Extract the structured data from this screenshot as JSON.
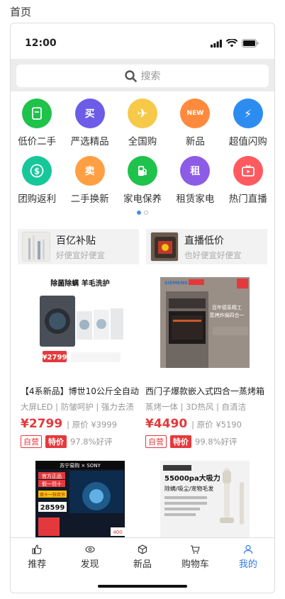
{
  "page_label": "首页",
  "status": {
    "time": "12:00"
  },
  "search": {
    "placeholder": "搜索"
  },
  "categories": [
    {
      "label": "低价二手",
      "color": "#1fc24b",
      "icon": "tablet-icon",
      "glyph": ""
    },
    {
      "label": "严选精品",
      "color": "#6c5ce7",
      "icon": "buy-icon",
      "glyph": "买"
    },
    {
      "label": "全国购",
      "color": "#f7c948",
      "icon": "plane-icon",
      "glyph": "✈"
    },
    {
      "label": "新品",
      "color": "#ff8a3d",
      "icon": "new-icon",
      "glyph": "NEW"
    },
    {
      "label": "超值闪购",
      "color": "#2d8cf0",
      "icon": "bolt-icon",
      "glyph": "⚡"
    },
    {
      "label": "团购返利",
      "color": "#16c79a",
      "icon": "dollar-icon",
      "glyph": "$"
    },
    {
      "label": "二手换新",
      "color": "#ff9f43",
      "icon": "sell-icon",
      "glyph": "卖"
    },
    {
      "label": "家电保养",
      "color": "#1fc24b",
      "icon": "fuel-icon",
      "glyph": "⛽"
    },
    {
      "label": "租赁家电",
      "color": "#8c5ce7",
      "icon": "rent-icon",
      "glyph": "租"
    },
    {
      "label": "热门直播",
      "color": "#ff5a5f",
      "icon": "tv-icon",
      "glyph": "▶"
    }
  ],
  "promos": [
    {
      "title": "百亿补贴",
      "sub": "好便宜好便宜"
    },
    {
      "title": "直播低价",
      "sub": "也好便宜好便宜"
    }
  ],
  "products": [
    {
      "name": "【4系新品】博世10公斤全自动",
      "tags": "大屏LED | 防皱呵护 | 强力去渍",
      "price": "¥2799",
      "orig": "原价 ¥3999",
      "badge1": "自营",
      "badge2": "特价",
      "rate": "97.8%好评",
      "img_title": "除菌除螨 羊毛洗护",
      "img_price": "2799"
    },
    {
      "name": "西门子爆款嵌入式四合一蒸烤箱",
      "tags": "蒸烤一体 | 3D热风 | 自清洁",
      "price": "¥4490",
      "orig": "原价 ¥5190",
      "badge1": "自营",
      "badge2": "特价",
      "rate": "99.8%好评",
      "img_brand": "SIEMENS",
      "img_text": "百年德系精工 蒸烤炸焗四合一"
    },
    {
      "img_top": "苏宁易购 × SONY",
      "img_line1": "官方正品",
      "img_line2": "假一罚十",
      "img_tag": "双十一狂欢节",
      "img_price": "28599",
      "img_small": "400"
    },
    {
      "img_top": "55000pa大吸力",
      "img_line1": "除螨/吸尘/宠物毛发"
    }
  ],
  "tabs": [
    {
      "label": "推荐",
      "icon": "thumbs-up-icon",
      "active": false
    },
    {
      "label": "发现",
      "icon": "eye-icon",
      "active": false
    },
    {
      "label": "新品",
      "icon": "cube-icon",
      "active": false
    },
    {
      "label": "购物车",
      "icon": "cart-icon",
      "active": false
    },
    {
      "label": "我的",
      "icon": "user-icon",
      "active": true
    }
  ]
}
